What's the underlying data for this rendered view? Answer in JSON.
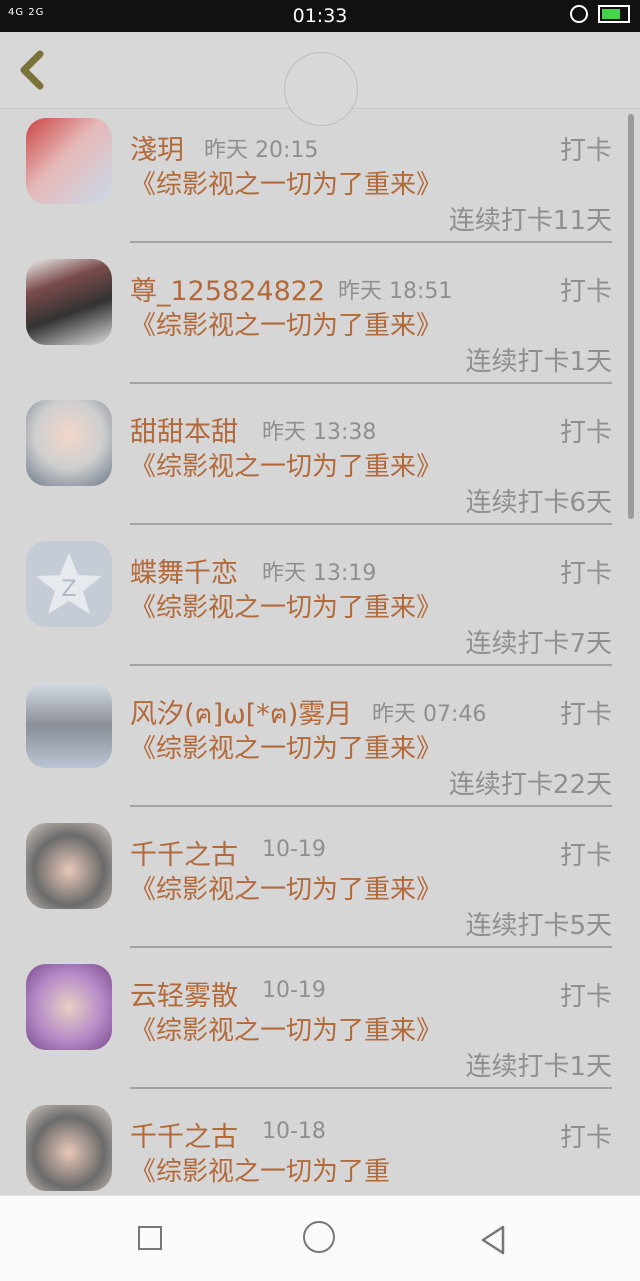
{
  "status_bar": {
    "network": "4G 2G",
    "time": "01:33"
  },
  "list": {
    "items": [
      {
        "name": "淺玥",
        "time": "昨天 20:15",
        "action": "打卡",
        "book": "《综影视之一切为了重来》",
        "streak": "连续打卡11天"
      },
      {
        "name": "尊_125824822",
        "time": "昨天 18:51",
        "action": "打卡",
        "book": "《综影视之一切为了重来》",
        "streak": "连续打卡1天"
      },
      {
        "name": "甜甜本甜",
        "time": "昨天 13:38",
        "action": "打卡",
        "book": "《综影视之一切为了重来》",
        "streak": "连续打卡6天"
      },
      {
        "name": "蝶舞千恋",
        "time": "昨天 13:19",
        "action": "打卡",
        "book": "《综影视之一切为了重来》",
        "streak": "连续打卡7天"
      },
      {
        "name": "风汐(ฅ]ω[*ฅ)雾月",
        "time": "昨天 07:46",
        "action": "打卡",
        "book": "《综影视之一切为了重来》",
        "streak": "连续打卡22天"
      },
      {
        "name": "千千之古",
        "time": "10-19",
        "action": "打卡",
        "book": "《综影视之一切为了重来》",
        "streak": "连续打卡5天"
      },
      {
        "name": "云轻雾散",
        "time": "10-19",
        "action": "打卡",
        "book": "《综影视之一切为了重来》",
        "streak": "连续打卡1天"
      },
      {
        "name": "千千之古",
        "time": "10-18",
        "action": "打卡",
        "book": "《综影视之一切为了重",
        "streak": ""
      }
    ]
  }
}
